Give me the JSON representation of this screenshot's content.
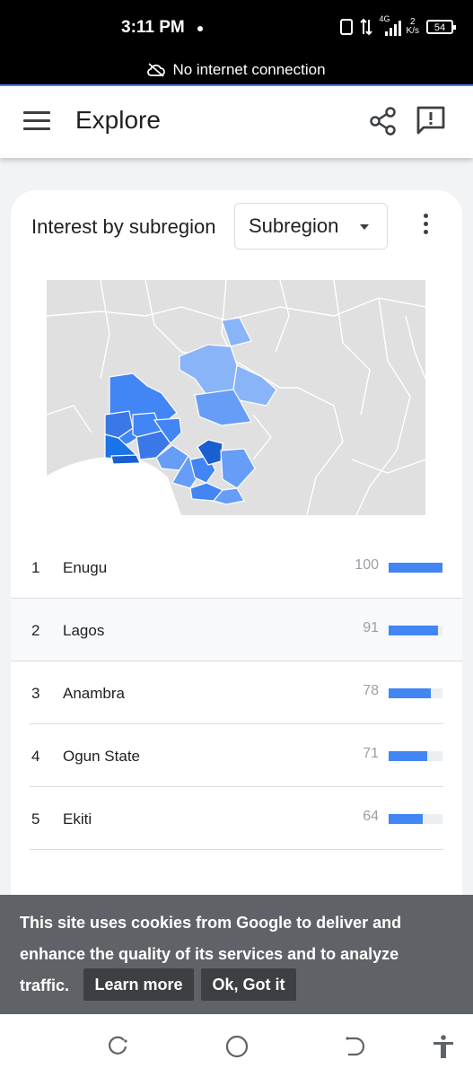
{
  "status_bar": {
    "time": "3:11 PM",
    "network_speed_value": "2",
    "network_speed_unit": "K/s",
    "network_type": "4G",
    "battery": "54",
    "connection_message": "No internet connection"
  },
  "app_bar": {
    "title": "Explore",
    "icons": [
      "menu-icon",
      "share-icon",
      "feedback-icon"
    ]
  },
  "card": {
    "title": "Interest by subregion",
    "dropdown_value": "Subregion",
    "colors": {
      "accent": "#4285f4",
      "map_base": "#e0e0e0"
    }
  },
  "rankings": [
    {
      "rank": "1",
      "name": "Enugu",
      "value": "100",
      "fraction": 1.0
    },
    {
      "rank": "2",
      "name": "Lagos",
      "value": "91",
      "fraction": 0.91
    },
    {
      "rank": "3",
      "name": "Anambra",
      "value": "78",
      "fraction": 0.78
    },
    {
      "rank": "4",
      "name": "Ogun State",
      "value": "71",
      "fraction": 0.71
    },
    {
      "rank": "5",
      "name": "Ekiti",
      "value": "64",
      "fraction": 0.64
    }
  ],
  "cookie": {
    "message": "This site uses cookies from Google to deliver and enhance the quality of its services and to analyze traffic.",
    "learn_more": "Learn more",
    "ok": "Ok, Got it"
  },
  "nav_bar": {
    "icons": [
      "recents-icon",
      "home-icon",
      "back-icon",
      "accessibility-icon"
    ]
  }
}
